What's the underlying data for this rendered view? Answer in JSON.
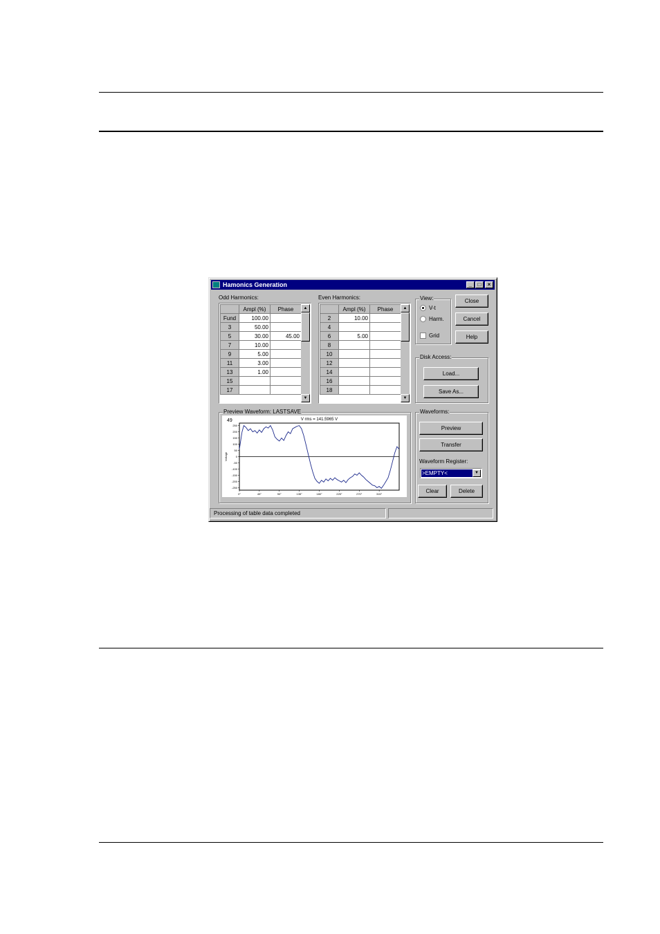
{
  "window": {
    "title": "Hamonics Generation",
    "buttons": {
      "minimize": "_",
      "maximize": "□",
      "close": "×"
    }
  },
  "odd": {
    "label": "Odd Harmonics:",
    "headers": [
      "",
      "Ampl (%)",
      "Phase"
    ],
    "rows": [
      [
        "Fund",
        "100.00",
        ""
      ],
      [
        "3",
        "50.00",
        ""
      ],
      [
        "5",
        "30.00",
        "45.00"
      ],
      [
        "7",
        "10.00",
        ""
      ],
      [
        "9",
        "5.00",
        ""
      ],
      [
        "11",
        "3.00",
        ""
      ],
      [
        "13",
        "1.00",
        ""
      ],
      [
        "15",
        "",
        ""
      ],
      [
        "17",
        "",
        ""
      ]
    ]
  },
  "even": {
    "label": "Even Harmonics:",
    "headers": [
      "",
      "Ampl (%)",
      "Phase"
    ],
    "rows": [
      [
        "2",
        "10.00",
        ""
      ],
      [
        "4",
        "",
        ""
      ],
      [
        "6",
        "5.00",
        ""
      ],
      [
        "8",
        "",
        ""
      ],
      [
        "10",
        "",
        ""
      ],
      [
        "12",
        "",
        ""
      ],
      [
        "14",
        "",
        ""
      ],
      [
        "16",
        "",
        ""
      ],
      [
        "18",
        "",
        ""
      ]
    ]
  },
  "view": {
    "label": "View:",
    "options": [
      "V-t",
      "Harm."
    ],
    "selected": "V-t",
    "grid_label": "Grid",
    "grid_checked": false
  },
  "actions": {
    "close": "Close",
    "cancel": "Cancel",
    "help": "Help"
  },
  "disk": {
    "label": "Disk Access:",
    "load": "Load...",
    "save_as": "Save As..."
  },
  "preview": {
    "label": "Preview Waveform: LASTSAVE"
  },
  "waveforms": {
    "label": "Waveforms:",
    "preview": "Preview",
    "transfer": "Transfer",
    "register_label": "Waveform Register:",
    "register_value": ">EMPTY<",
    "clear": "Clear",
    "delete": "Delete"
  },
  "status": {
    "text": "Processing of table data completed"
  },
  "chart_data": {
    "type": "line",
    "title": "V rms = 141.5965 V",
    "ylabel": "Voltage",
    "corner_label": "49",
    "xlim": [
      0,
      360
    ],
    "ylim": [
      -270,
      270
    ],
    "x_ticks": [
      "0°",
      "45°",
      "90°",
      "135°",
      "180°",
      "225°",
      "270°",
      "315°"
    ],
    "y_ticks": [
      "250",
      "200",
      "150",
      "100",
      "50",
      "0",
      "-50",
      "-100",
      "-150",
      "-200",
      "-250"
    ],
    "series": [
      {
        "x": [
          0,
          6,
          10,
          15,
          20,
          25,
          30,
          35,
          40,
          45,
          50,
          55,
          60,
          65,
          70,
          75,
          80,
          85,
          90,
          95,
          100,
          105,
          110,
          115,
          120,
          125,
          130,
          135,
          140,
          145,
          150,
          155,
          160,
          165,
          170,
          175,
          180,
          185,
          190,
          195,
          200,
          205,
          210,
          215,
          220,
          225,
          230,
          235,
          240,
          245,
          250,
          255,
          260,
          265,
          270,
          275,
          280,
          285,
          290,
          295,
          300,
          305,
          310,
          315,
          320,
          325,
          330,
          335,
          340,
          345,
          350,
          355,
          360
        ],
        "y": [
          60,
          200,
          250,
          235,
          210,
          225,
          200,
          210,
          190,
          215,
          195,
          225,
          240,
          230,
          250,
          215,
          160,
          140,
          125,
          150,
          130,
          170,
          200,
          185,
          225,
          235,
          245,
          250,
          225,
          170,
          95,
          20,
          -55,
          -120,
          -175,
          -200,
          -215,
          -190,
          -205,
          -180,
          -195,
          -175,
          -190,
          -170,
          -185,
          -195,
          -205,
          -190,
          -210,
          -185,
          -170,
          -160,
          -140,
          -150,
          -130,
          -150,
          -165,
          -185,
          -200,
          -215,
          -230,
          -235,
          -250,
          -240,
          -255,
          -230,
          -200,
          -170,
          -110,
          -40,
          30,
          80,
          60
        ]
      }
    ]
  }
}
